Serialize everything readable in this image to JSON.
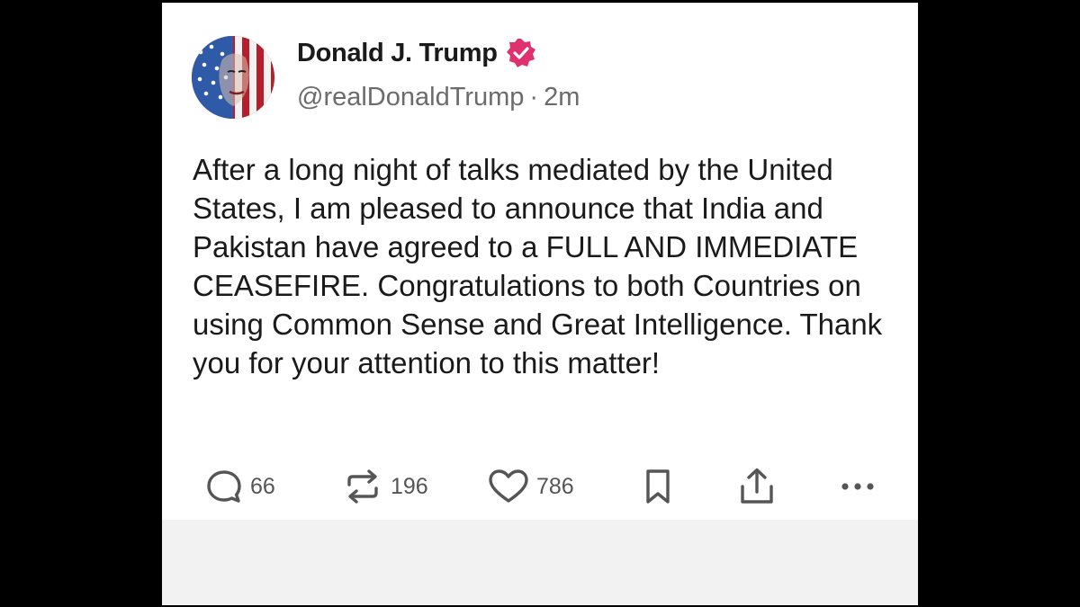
{
  "post": {
    "author_name": "Donald J. Trump",
    "handle": "@realDonaldTrump",
    "separator": "·",
    "time_ago": "2m",
    "verified_badge_color": "#e0316e",
    "avatar_icon": "flag-face-avatar",
    "text": "After a long night of talks mediated by the United States, I am pleased to announce that India and Pakistan have agreed to a FULL AND IMMEDIATE CEASEFIRE. Congratulations to both Countries on using Common Sense and Great Intelligence. Thank you for your attention to this matter!"
  },
  "actions": {
    "replies_count": "66",
    "reposts_count": "196",
    "likes_count": "786",
    "icons": [
      "reply-icon",
      "repost-icon",
      "heart-icon",
      "bookmark-icon",
      "share-icon",
      "more-icon"
    ]
  },
  "colors": {
    "card_background": "#ffffff",
    "footer_background": "#f2f2f2",
    "text_primary": "#1a1a1a",
    "text_secondary": "#6b6b6b",
    "icon_color": "#555555"
  }
}
